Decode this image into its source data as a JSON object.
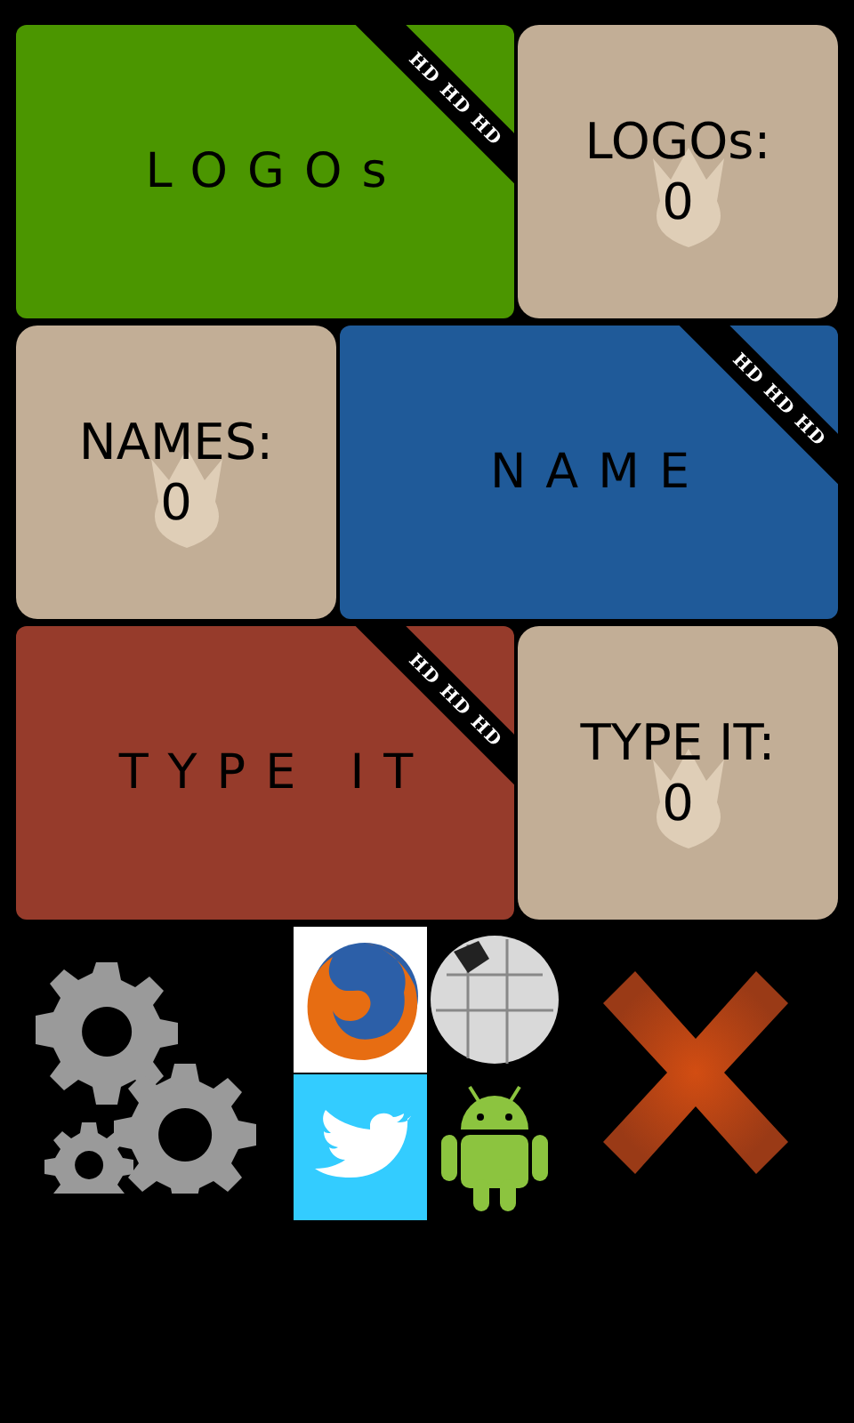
{
  "tiles": [
    {
      "cells": [
        {
          "kind": "mode",
          "title": "LOGOs",
          "color": "#4b9600",
          "ribbon": "HD HD HD"
        },
        {
          "kind": "score",
          "label": "LOGOs:",
          "value": "0"
        }
      ]
    },
    {
      "cells": [
        {
          "kind": "score",
          "label": "NAMES:",
          "value": "0"
        },
        {
          "kind": "mode",
          "title": "NAME",
          "color": "#1f5a99",
          "ribbon": "HD HD HD"
        }
      ]
    },
    {
      "cells": [
        {
          "kind": "mode",
          "title": "TYPE IT",
          "color": "#963b2b",
          "ribbon": "HD HD HD"
        },
        {
          "kind": "score",
          "label": "TYPE IT:",
          "value": "0"
        }
      ]
    }
  ],
  "toolbar": [
    {
      "kind": "settings"
    },
    {
      "kind": "apps"
    },
    {
      "kind": "close"
    }
  ]
}
